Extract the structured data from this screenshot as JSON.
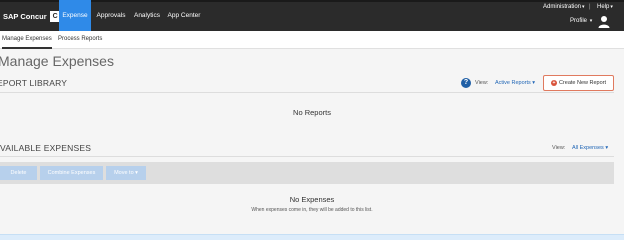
{
  "topbar": {
    "logo_text": "SAP Concur",
    "logo_mark": "C",
    "tabs": [
      {
        "label": "Expense",
        "active": true
      },
      {
        "label": "Approvals",
        "active": false
      },
      {
        "label": "Analytics",
        "active": false
      },
      {
        "label": "App Center",
        "active": false
      }
    ],
    "administration_label": "Administration",
    "separator": "|",
    "help_label": "Help",
    "profile_label": "Profile",
    "caret": "▾",
    "avatar_icon": "user-avatar-icon",
    "accent_color": "#2f8ae8"
  },
  "subnav": {
    "items": [
      {
        "label": "Manage Expenses",
        "active": true
      },
      {
        "label": "Process Reports",
        "active": false
      }
    ]
  },
  "page": {
    "title": "Manage Expenses"
  },
  "report_library": {
    "title": "REPORT LIBRARY",
    "help_icon": "question-circle-icon",
    "help_glyph": "?",
    "view_label": "View:",
    "view_value": "Active Reports",
    "create_label": "Create New Report",
    "create_glyph": "+",
    "empty_message": "No Reports"
  },
  "available_expenses": {
    "title": "VAILABLE EXPENSES",
    "view_label": "View:",
    "view_value": "All Expenses",
    "toolbar": {
      "delete_label": "Delete",
      "combine_label": "Combine Expenses",
      "move_label": "Move to"
    },
    "empty_message": "No Expenses",
    "empty_sub": "When expenses come in, they will be added to this list."
  },
  "page_title_display": "Manage Expenses",
  "report_library_display": "EPORT LIBRARY"
}
